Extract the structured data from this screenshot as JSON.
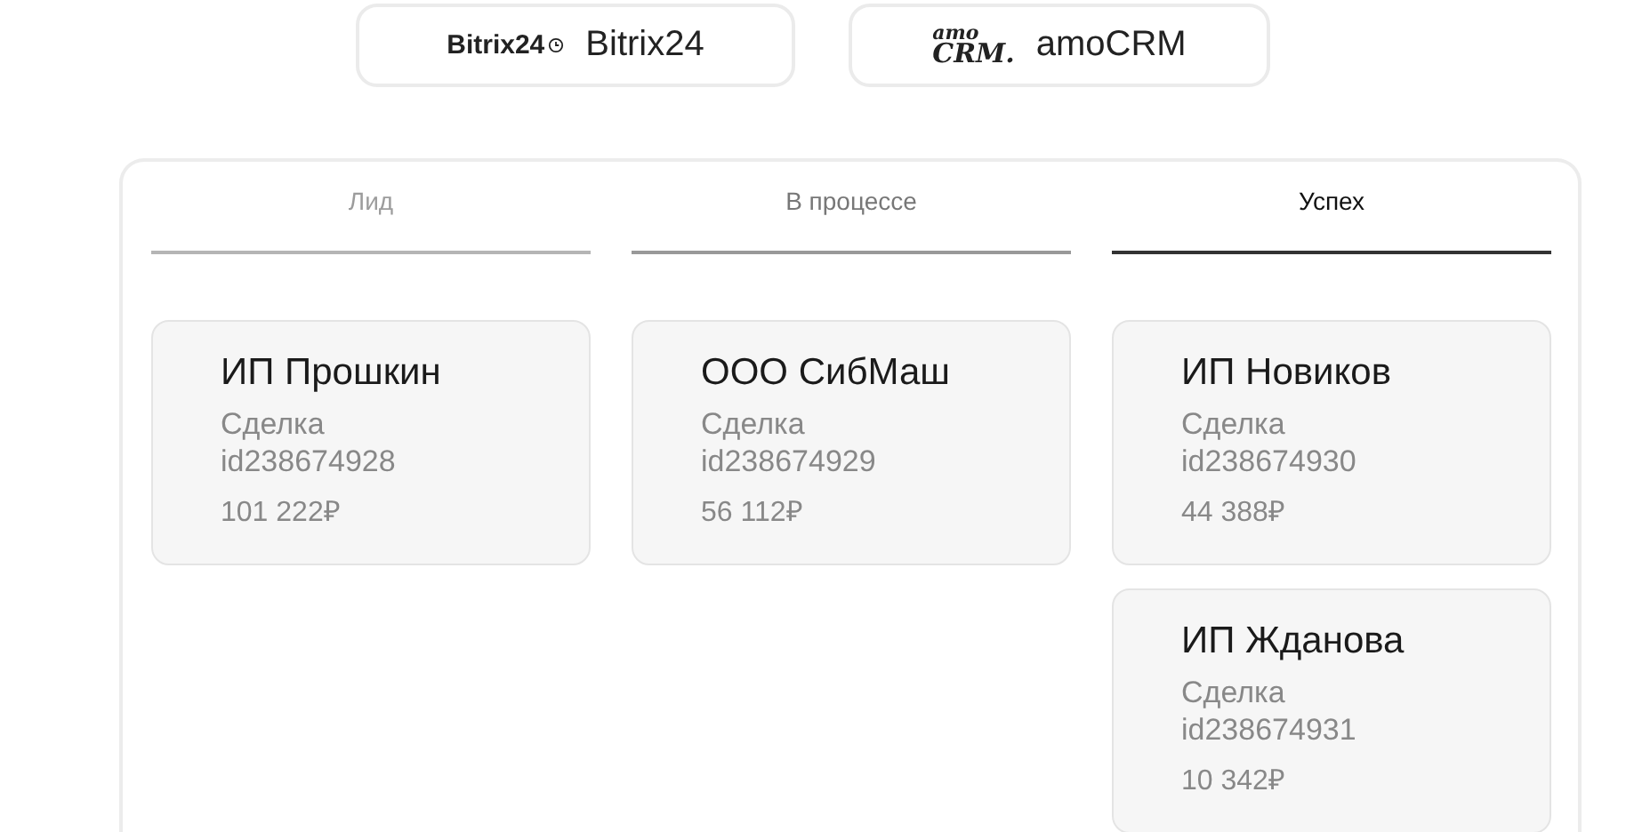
{
  "integrations": [
    {
      "kind": "bitrix",
      "logo": "Bitrix24",
      "label": "Bitrix24"
    },
    {
      "kind": "amo",
      "logo_top": "amo",
      "logo_bottom": "CRM.",
      "label": "amoCRM"
    }
  ],
  "columns": [
    {
      "title": "Лид",
      "selected": false,
      "faded": true,
      "deals": [
        {
          "company": "ИП Прошкин",
          "type": "Сделка",
          "id": "id238674928",
          "amount": "101 222₽"
        }
      ]
    },
    {
      "title": "В процессе",
      "selected": false,
      "faded": false,
      "deals": [
        {
          "company": "ООО СибМаш",
          "type": "Сделка",
          "id": "id238674929",
          "amount": "56 112₽"
        }
      ]
    },
    {
      "title": "Успех",
      "selected": true,
      "faded": false,
      "deals": [
        {
          "company": "ИП Новиков",
          "type": "Сделка",
          "id": "id238674930",
          "amount": "44 388₽"
        },
        {
          "company": "ИП Жданова",
          "type": "Сделка",
          "id": "id238674931",
          "amount": "10 342₽"
        }
      ]
    }
  ]
}
